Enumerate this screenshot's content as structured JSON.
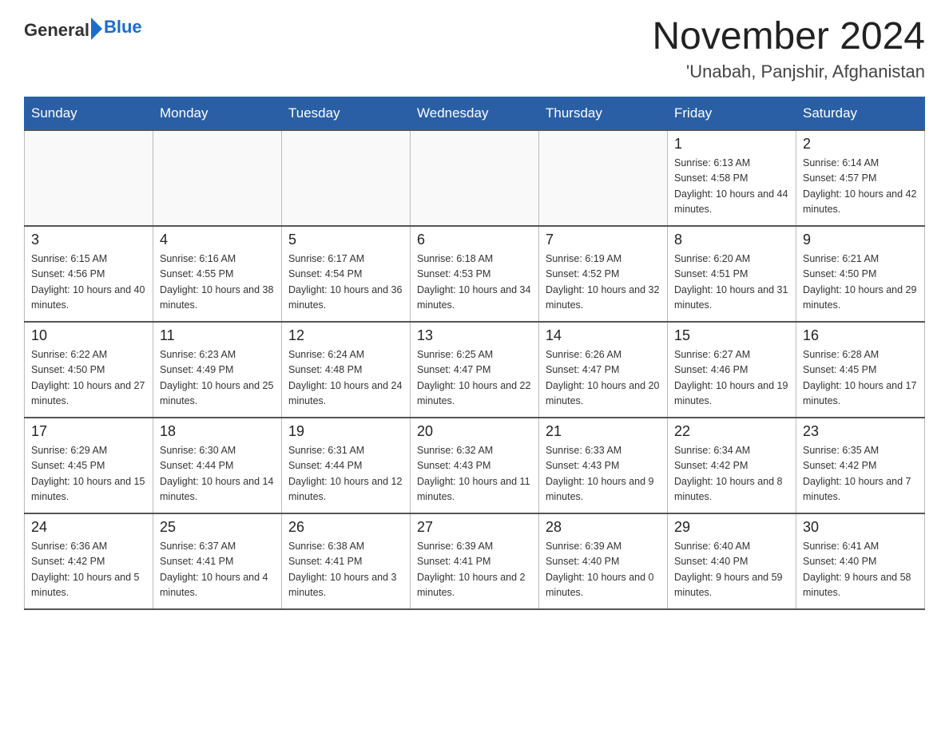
{
  "header": {
    "logo_general": "General",
    "logo_blue": "Blue",
    "month_title": "November 2024",
    "location": "'Unabah, Panjshir, Afghanistan"
  },
  "weekdays": [
    "Sunday",
    "Monday",
    "Tuesday",
    "Wednesday",
    "Thursday",
    "Friday",
    "Saturday"
  ],
  "weeks": [
    [
      {
        "day": "",
        "info": ""
      },
      {
        "day": "",
        "info": ""
      },
      {
        "day": "",
        "info": ""
      },
      {
        "day": "",
        "info": ""
      },
      {
        "day": "",
        "info": ""
      },
      {
        "day": "1",
        "info": "Sunrise: 6:13 AM\nSunset: 4:58 PM\nDaylight: 10 hours and 44 minutes."
      },
      {
        "day": "2",
        "info": "Sunrise: 6:14 AM\nSunset: 4:57 PM\nDaylight: 10 hours and 42 minutes."
      }
    ],
    [
      {
        "day": "3",
        "info": "Sunrise: 6:15 AM\nSunset: 4:56 PM\nDaylight: 10 hours and 40 minutes."
      },
      {
        "day": "4",
        "info": "Sunrise: 6:16 AM\nSunset: 4:55 PM\nDaylight: 10 hours and 38 minutes."
      },
      {
        "day": "5",
        "info": "Sunrise: 6:17 AM\nSunset: 4:54 PM\nDaylight: 10 hours and 36 minutes."
      },
      {
        "day": "6",
        "info": "Sunrise: 6:18 AM\nSunset: 4:53 PM\nDaylight: 10 hours and 34 minutes."
      },
      {
        "day": "7",
        "info": "Sunrise: 6:19 AM\nSunset: 4:52 PM\nDaylight: 10 hours and 32 minutes."
      },
      {
        "day": "8",
        "info": "Sunrise: 6:20 AM\nSunset: 4:51 PM\nDaylight: 10 hours and 31 minutes."
      },
      {
        "day": "9",
        "info": "Sunrise: 6:21 AM\nSunset: 4:50 PM\nDaylight: 10 hours and 29 minutes."
      }
    ],
    [
      {
        "day": "10",
        "info": "Sunrise: 6:22 AM\nSunset: 4:50 PM\nDaylight: 10 hours and 27 minutes."
      },
      {
        "day": "11",
        "info": "Sunrise: 6:23 AM\nSunset: 4:49 PM\nDaylight: 10 hours and 25 minutes."
      },
      {
        "day": "12",
        "info": "Sunrise: 6:24 AM\nSunset: 4:48 PM\nDaylight: 10 hours and 24 minutes."
      },
      {
        "day": "13",
        "info": "Sunrise: 6:25 AM\nSunset: 4:47 PM\nDaylight: 10 hours and 22 minutes."
      },
      {
        "day": "14",
        "info": "Sunrise: 6:26 AM\nSunset: 4:47 PM\nDaylight: 10 hours and 20 minutes."
      },
      {
        "day": "15",
        "info": "Sunrise: 6:27 AM\nSunset: 4:46 PM\nDaylight: 10 hours and 19 minutes."
      },
      {
        "day": "16",
        "info": "Sunrise: 6:28 AM\nSunset: 4:45 PM\nDaylight: 10 hours and 17 minutes."
      }
    ],
    [
      {
        "day": "17",
        "info": "Sunrise: 6:29 AM\nSunset: 4:45 PM\nDaylight: 10 hours and 15 minutes."
      },
      {
        "day": "18",
        "info": "Sunrise: 6:30 AM\nSunset: 4:44 PM\nDaylight: 10 hours and 14 minutes."
      },
      {
        "day": "19",
        "info": "Sunrise: 6:31 AM\nSunset: 4:44 PM\nDaylight: 10 hours and 12 minutes."
      },
      {
        "day": "20",
        "info": "Sunrise: 6:32 AM\nSunset: 4:43 PM\nDaylight: 10 hours and 11 minutes."
      },
      {
        "day": "21",
        "info": "Sunrise: 6:33 AM\nSunset: 4:43 PM\nDaylight: 10 hours and 9 minutes."
      },
      {
        "day": "22",
        "info": "Sunrise: 6:34 AM\nSunset: 4:42 PM\nDaylight: 10 hours and 8 minutes."
      },
      {
        "day": "23",
        "info": "Sunrise: 6:35 AM\nSunset: 4:42 PM\nDaylight: 10 hours and 7 minutes."
      }
    ],
    [
      {
        "day": "24",
        "info": "Sunrise: 6:36 AM\nSunset: 4:42 PM\nDaylight: 10 hours and 5 minutes."
      },
      {
        "day": "25",
        "info": "Sunrise: 6:37 AM\nSunset: 4:41 PM\nDaylight: 10 hours and 4 minutes."
      },
      {
        "day": "26",
        "info": "Sunrise: 6:38 AM\nSunset: 4:41 PM\nDaylight: 10 hours and 3 minutes."
      },
      {
        "day": "27",
        "info": "Sunrise: 6:39 AM\nSunset: 4:41 PM\nDaylight: 10 hours and 2 minutes."
      },
      {
        "day": "28",
        "info": "Sunrise: 6:39 AM\nSunset: 4:40 PM\nDaylight: 10 hours and 0 minutes."
      },
      {
        "day": "29",
        "info": "Sunrise: 6:40 AM\nSunset: 4:40 PM\nDaylight: 9 hours and 59 minutes."
      },
      {
        "day": "30",
        "info": "Sunrise: 6:41 AM\nSunset: 4:40 PM\nDaylight: 9 hours and 58 minutes."
      }
    ]
  ]
}
